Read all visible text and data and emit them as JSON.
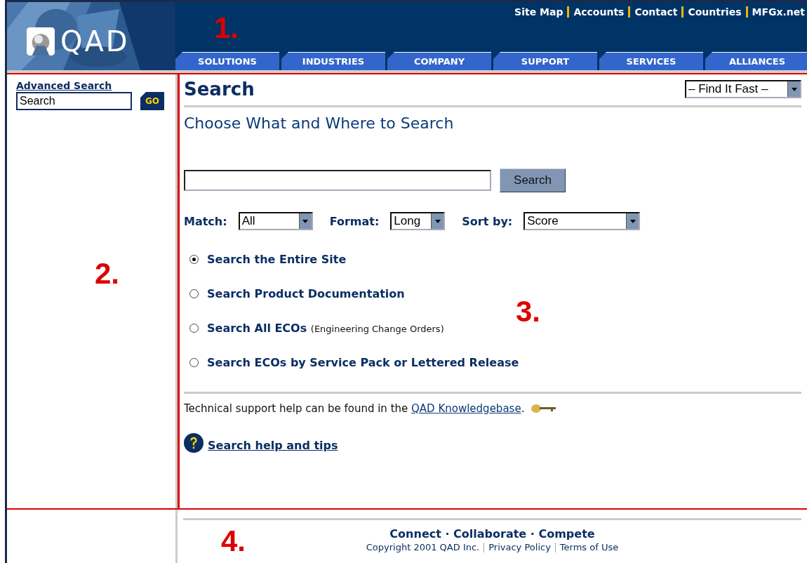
{
  "header": {
    "logo": {
      "text": "QAD"
    },
    "top_links": [
      "Site Map",
      "Accounts",
      "Contact",
      "Countries",
      "MFGx.net"
    ],
    "tabs": [
      {
        "label": "SOLUTIONS",
        "selected": false
      },
      {
        "label": "INDUSTRIES",
        "selected": false
      },
      {
        "label": "COMPANY",
        "selected": false
      },
      {
        "label": "SUPPORT",
        "selected": false
      },
      {
        "label": "SERVICES",
        "selected": false
      },
      {
        "label": "ALLIANCES",
        "selected": false
      }
    ]
  },
  "sidebar": {
    "advanced_search_link": "Advanced Search",
    "search_field": {
      "value": "Search"
    },
    "go_button": "GO"
  },
  "main": {
    "title": "Search",
    "find_it_fast": {
      "value": "– Find It Fast –"
    },
    "subtitle": "Choose What and Where to Search",
    "search_button": "Search",
    "filters": [
      {
        "label": "Match:",
        "value": "All"
      },
      {
        "label": "Format:",
        "value": "Long"
      },
      {
        "label": "Sort by:",
        "value": "Score"
      }
    ],
    "scopes": [
      {
        "label": "Search the Entire Site",
        "selected": true
      },
      {
        "label": "Search Product Documentation",
        "selected": false
      },
      {
        "label": "Search All ECOs",
        "note": "(Engineering Change Orders)",
        "selected": false
      },
      {
        "label": "Search ECOs by Service Pack or Lettered Release",
        "selected": false
      }
    ],
    "support_text": "Technical support help can be found in the",
    "support_link": "QAD Knowledgebase",
    "support_end": ".",
    "help_link": "Search help and tips"
  },
  "footer": {
    "tagline": "Connect · Collaborate · Compete",
    "copyright": "Copyright 2001 QAD Inc.",
    "links": [
      "Privacy Policy",
      "Terms of Use"
    ]
  },
  "annotations": [
    "1.",
    "2.",
    "3.",
    "4."
  ]
}
